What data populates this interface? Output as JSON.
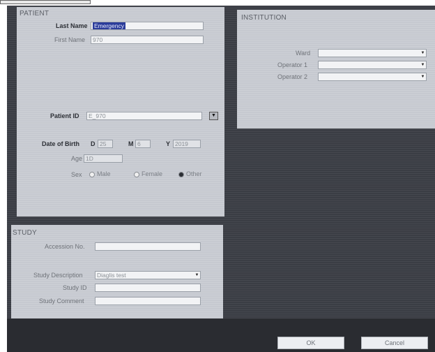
{
  "patient": {
    "section_title": "PATIENT",
    "last_name_label": "Last Name",
    "last_name_value": "Emergency",
    "first_name_label": "First Name",
    "first_name_value": "970",
    "patient_id_label": "Patient ID",
    "patient_id_value": "E_970",
    "dob_label": "Date of Birth",
    "dob_d_label": "D",
    "dob_d_value": "25",
    "dob_m_label": "M",
    "dob_m_value": "6",
    "dob_y_label": "Y",
    "dob_y_value": "2019",
    "age_label": "Age",
    "age_value": "1D",
    "sex_label": "Sex",
    "sex_options": [
      "Male",
      "Female",
      "Other"
    ],
    "sex_selected": "Other"
  },
  "institution": {
    "section_title": "INSTITUTION",
    "ward_label": "Ward",
    "ward_value": "",
    "operator1_label": "Operator 1",
    "operator1_value": "",
    "operator2_label": "Operator 2",
    "operator2_value": ""
  },
  "study": {
    "section_title": "STUDY",
    "accession_label": "Accession No.",
    "accession_value": "",
    "description_label": "Study Description",
    "description_value": "Diaglis test",
    "study_id_label": "Study ID",
    "study_id_value": "",
    "comment_label": "Study Comment",
    "comment_value": ""
  },
  "buttons": {
    "ok": "OK",
    "cancel": "Cancel"
  }
}
